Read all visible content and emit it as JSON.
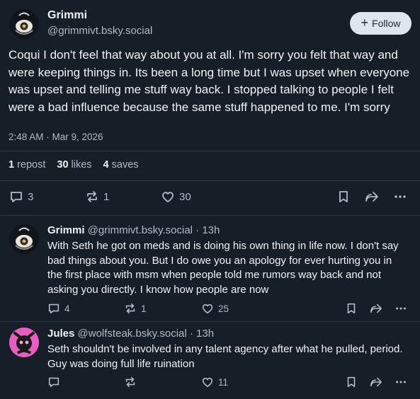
{
  "main_post": {
    "display_name": "Grimmi",
    "handle": "@grimmivt.bsky.social",
    "follow_label": "Follow",
    "text": "Coqui I don't feel that way about you at all. I'm sorry you felt that way and were keeping things in. Its been a long time but I was upset when everyone was upset and telling me stuff way back. I stopped talking to people I felt were a bad influence because the same stuff happened to me. I'm sorry",
    "timestamp": "2:48 AM · Mar 9, 2026",
    "stats": {
      "reposts_count": "1",
      "reposts_label": "repost",
      "likes_count": "30",
      "likes_label": "likes",
      "saves_count": "4",
      "saves_label": "saves"
    },
    "actions": {
      "replies": "3",
      "reposts": "1",
      "likes": "30"
    }
  },
  "replies": [
    {
      "display_name": "Grimmi",
      "handle": "@grimmivt.bsky.social",
      "time": "· 13h",
      "text": "With Seth he got on meds and is doing his own thing in life now. I don't say bad things about you. But I do owe you an apology for ever hurting you in the first place with msm when people told me rumors way back and not asking you directly. I know how people are now",
      "actions": {
        "replies": "4",
        "reposts": "1",
        "likes": "25"
      }
    },
    {
      "display_name": "Jules",
      "handle": "@wolfsteak.bsky.social",
      "time": "· 13h",
      "text": "Seth shouldn't be involved in any talent agency after what he pulled, period. Guy was doing full life ruination",
      "actions": {
        "replies": "",
        "reposts": "",
        "likes": "11"
      }
    }
  ],
  "colors": {
    "background": "#161e27",
    "text": "#f1f3f5",
    "muted": "#aebbc9",
    "divider": "#2c3947",
    "follow_button_bg": "#dfe5ec",
    "jules_avatar": "#e85ec0"
  }
}
